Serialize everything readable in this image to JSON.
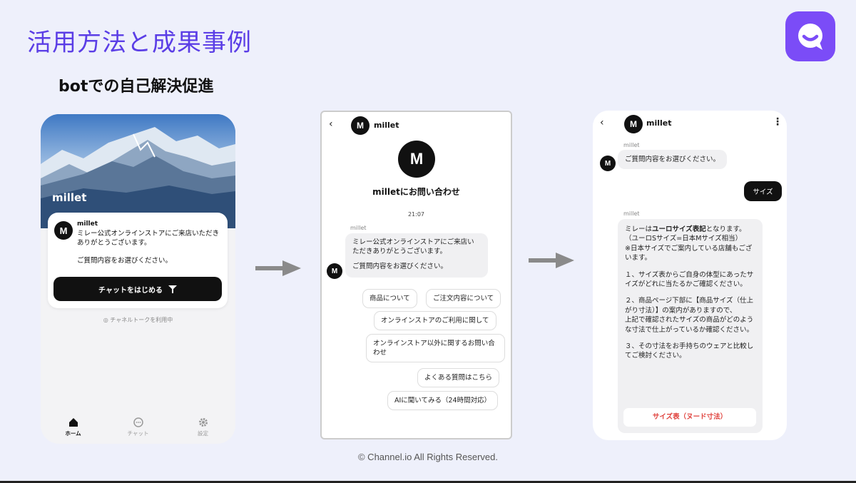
{
  "slide": {
    "title": "活用方法と成果事例",
    "subtitle": "botでの自己解決促進",
    "footer": "© Channel.io  All Rights Reserved.",
    "accent_color": "#5b3ee6",
    "logo_icon": "channel-talk-logo"
  },
  "screen1": {
    "hero_name": "millet",
    "bot_name": "millet",
    "avatar_letter": "M",
    "message_line1": "ミレー公式オンラインストアにご来店いただきありがとうございます。",
    "message_line2": "ご質問内容をお選びください。",
    "start_button": "チャットをはじめる",
    "powered_by": "チャネルトークを利用中",
    "tabs": [
      {
        "label": "ホーム",
        "icon": "home-icon"
      },
      {
        "label": "チャット",
        "icon": "chat-icon"
      },
      {
        "label": "設定",
        "icon": "gear-icon"
      }
    ]
  },
  "screen2": {
    "header_name": "millet",
    "logo_letter": "M",
    "contact_title": "milletにお問い合わせ",
    "time": "21:07",
    "sender": "millet",
    "message_line1": "ミレー公式オンラインストアにご来店いただきありがとうございます。",
    "message_line2": "ご質問内容をお選びください。",
    "options": [
      "商品について",
      "ご注文内容について",
      "オンラインストアのご利用に関して",
      "オンラインストア以外に関するお問い合わせ",
      "よくある質問はこちら",
      "AIに聞いてみる（24時間対応）"
    ]
  },
  "screen3": {
    "header_name": "millet",
    "sender": "millet",
    "bot_message": "ご質問内容をお選びください。",
    "user_reply": "サイズ",
    "answer_intro_plain": "ミレーは",
    "answer_intro_bold": "ユーロサイズ表記",
    "answer_intro_tail": "となります。",
    "answer_note1": "（ユーロSサイズ=日本Mサイズ相当）",
    "answer_note2": "※日本サイズでご案内している店舗もございます。",
    "answer_step1": "１、サイズ表からご自身の体型にあったサイズがどれに当たるかご確認ください。",
    "answer_step2": "２、商品ページ下部に【商品サイズ（仕上がり寸法）】の案内がありますので、",
    "answer_step2b": "上記で確認されたサイズの商品がどのような寸法で仕上がっているか確認ください。",
    "answer_step3": "３、その寸法をお手持ちのウェアと比較してご検討ください。",
    "size_button": "サイズ表（ヌード寸法）",
    "size_button_color": "#e0423d"
  }
}
